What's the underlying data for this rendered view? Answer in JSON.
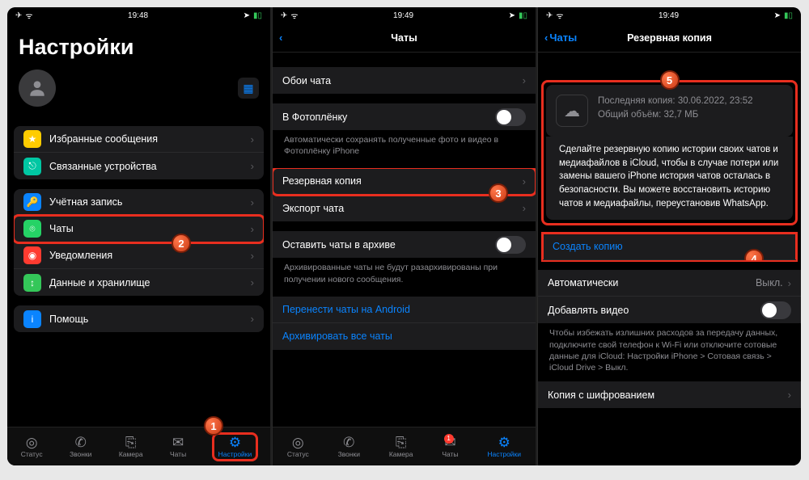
{
  "statusbar": {
    "time1": "19:48",
    "time2": "19:49",
    "time3": "19:49"
  },
  "panel1": {
    "title": "Настройки",
    "groups": [
      [
        {
          "icon": "★",
          "bg": "#ffcc00",
          "label": "Избранные сообщения"
        },
        {
          "icon": "⎋",
          "bg": "#00c7a3",
          "label": "Связанные устройства"
        }
      ],
      [
        {
          "icon": "🔑",
          "bg": "#0a84ff",
          "label": "Учётная запись"
        },
        {
          "icon": "⌾",
          "bg": "#25d366",
          "label": "Чаты",
          "highlight": true
        },
        {
          "icon": "◉",
          "bg": "#ff3b30",
          "label": "Уведомления"
        },
        {
          "icon": "↕",
          "bg": "#34c759",
          "label": "Данные и хранилище"
        }
      ],
      [
        {
          "icon": "i",
          "bg": "#0a84ff",
          "label": "Помощь"
        }
      ]
    ],
    "tabs": {
      "status": "Статус",
      "calls": "Звонки",
      "camera": "Камера",
      "chats": "Чаты",
      "settings": "Настройки"
    },
    "step1": "1",
    "step2": "2"
  },
  "panel2": {
    "title": "Чаты",
    "wallpaper": "Обои чата",
    "cameraRoll": "В Фотоплёнку",
    "cameraRollNote": "Автоматически сохранять полученные фото и видео в Фотоплёнку iPhone",
    "backup": "Резервная копия",
    "export": "Экспорт чата",
    "archive": "Оставить чаты в архиве",
    "archiveNote": "Архивированные чаты не будут разархивированы при получении нового сообщения.",
    "moveAndroid": "Перенести чаты на Android",
    "archiveAll": "Архивировать все чаты",
    "tabs": {
      "status": "Статус",
      "calls": "Звонки",
      "camera": "Камера",
      "chats": "Чаты",
      "settings": "Настройки",
      "badge": "1"
    },
    "step3": "3"
  },
  "panel3": {
    "back": "Чаты",
    "title": "Резервная копия",
    "lastLabel": "Последняя копия:",
    "lastValue": "30.06.2022, 23:52",
    "sizeLabel": "Общий объём:",
    "sizeValue": "32,7 МБ",
    "desc": "Сделайте резервную копию истории своих чатов и медиафайлов в iCloud, чтобы в случае потери или замены вашего iPhone история чатов осталась в безопасности. Вы можете восстановить историю чатов и медиафайлы, переустановив WhatsApp.",
    "createBackup": "Создать копию",
    "auto": "Автоматически",
    "autoValue": "Выкл.",
    "includeVideo": "Добавлять видео",
    "note": "Чтобы избежать излишних расходов за передачу данных, подключите свой телефон к Wi-Fi или отключите сотовые данные для iCloud: Настройки iPhone > Сотовая связь > iCloud Drive > Выкл.",
    "encrypted": "Копия с шифрованием",
    "step4": "4",
    "step5": "5"
  }
}
